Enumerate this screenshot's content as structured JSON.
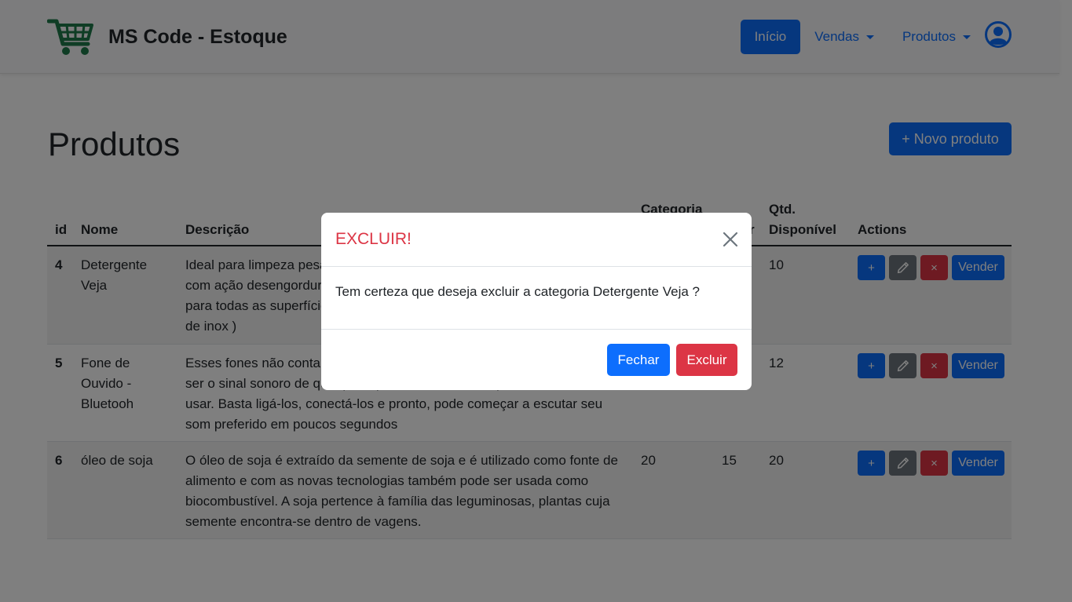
{
  "header": {
    "brand": "MS Code - Estoque",
    "nav": {
      "inicio": "Início",
      "vendas": "Vendas",
      "produtos": "Produtos"
    }
  },
  "page": {
    "title": "Produtos",
    "new_button": "+ Novo produto"
  },
  "table": {
    "headers": {
      "id": "id",
      "nome": "Nome",
      "descricao": "Descrição",
      "categoria": "Categoria",
      "valor_frag": "r",
      "qtd": "Qtd.",
      "disponivel": "Disponível",
      "actions": "Actions"
    },
    "rows": [
      {
        "id": "4",
        "nome": "Detergente Veja",
        "descricao": "Ideal para limpeza pesada de cozinha e banheiro, sua exclusiva fórmula com ação desengordurante remove a sujeira garantindo máxima limpeza para todas as superfícies laváveis ( cerâmica, porcelanato, azulejos, pias de inox )",
        "categoria": "",
        "valor": "",
        "disponivel": "10"
      },
      {
        "id": "5",
        "nome": "Fone de Ouvido - Bluetooh",
        "descricao": "Esses fones não contam com fio para a transmissão do áudio, que pode ser o sinal sonoro de qualquer aparelho, muito mais prático e fácil de usar. Basta ligá-los, conectá-los e pronto, pode começar a escutar seu som preferido em poucos segundos",
        "categoria": "",
        "valor": "",
        "disponivel": "12"
      },
      {
        "id": "6",
        "nome": "óleo de soja",
        "descricao": "O óleo de soja é extraído da semente de soja e é utilizado como fonte de alimento e com as novas tecnologias também pode ser usada como biocombustível. A soja pertence à família das leguminosas, plantas cuja semente encontra-se dentro de vagens.",
        "categoria": "20",
        "valor": "15",
        "disponivel": "20"
      }
    ],
    "action_labels": {
      "plus": "+",
      "delete": "×",
      "sell": "Vender"
    }
  },
  "modal": {
    "title": "EXCLUIR!",
    "message": "Tem certeza que deseja excluir a categoria Detergente Veja ?",
    "close_label": "Fechar",
    "confirm_label": "Excluir"
  },
  "icons": {
    "brand": "shopping-cart-icon",
    "avatar": "user-circle-icon",
    "edit": "pencil-icon",
    "close": "close-icon"
  },
  "colors": {
    "primary": "#0d6efd",
    "danger": "#dc3545",
    "secondary": "#6c757d",
    "brand_icon": "#1f7a4a"
  }
}
